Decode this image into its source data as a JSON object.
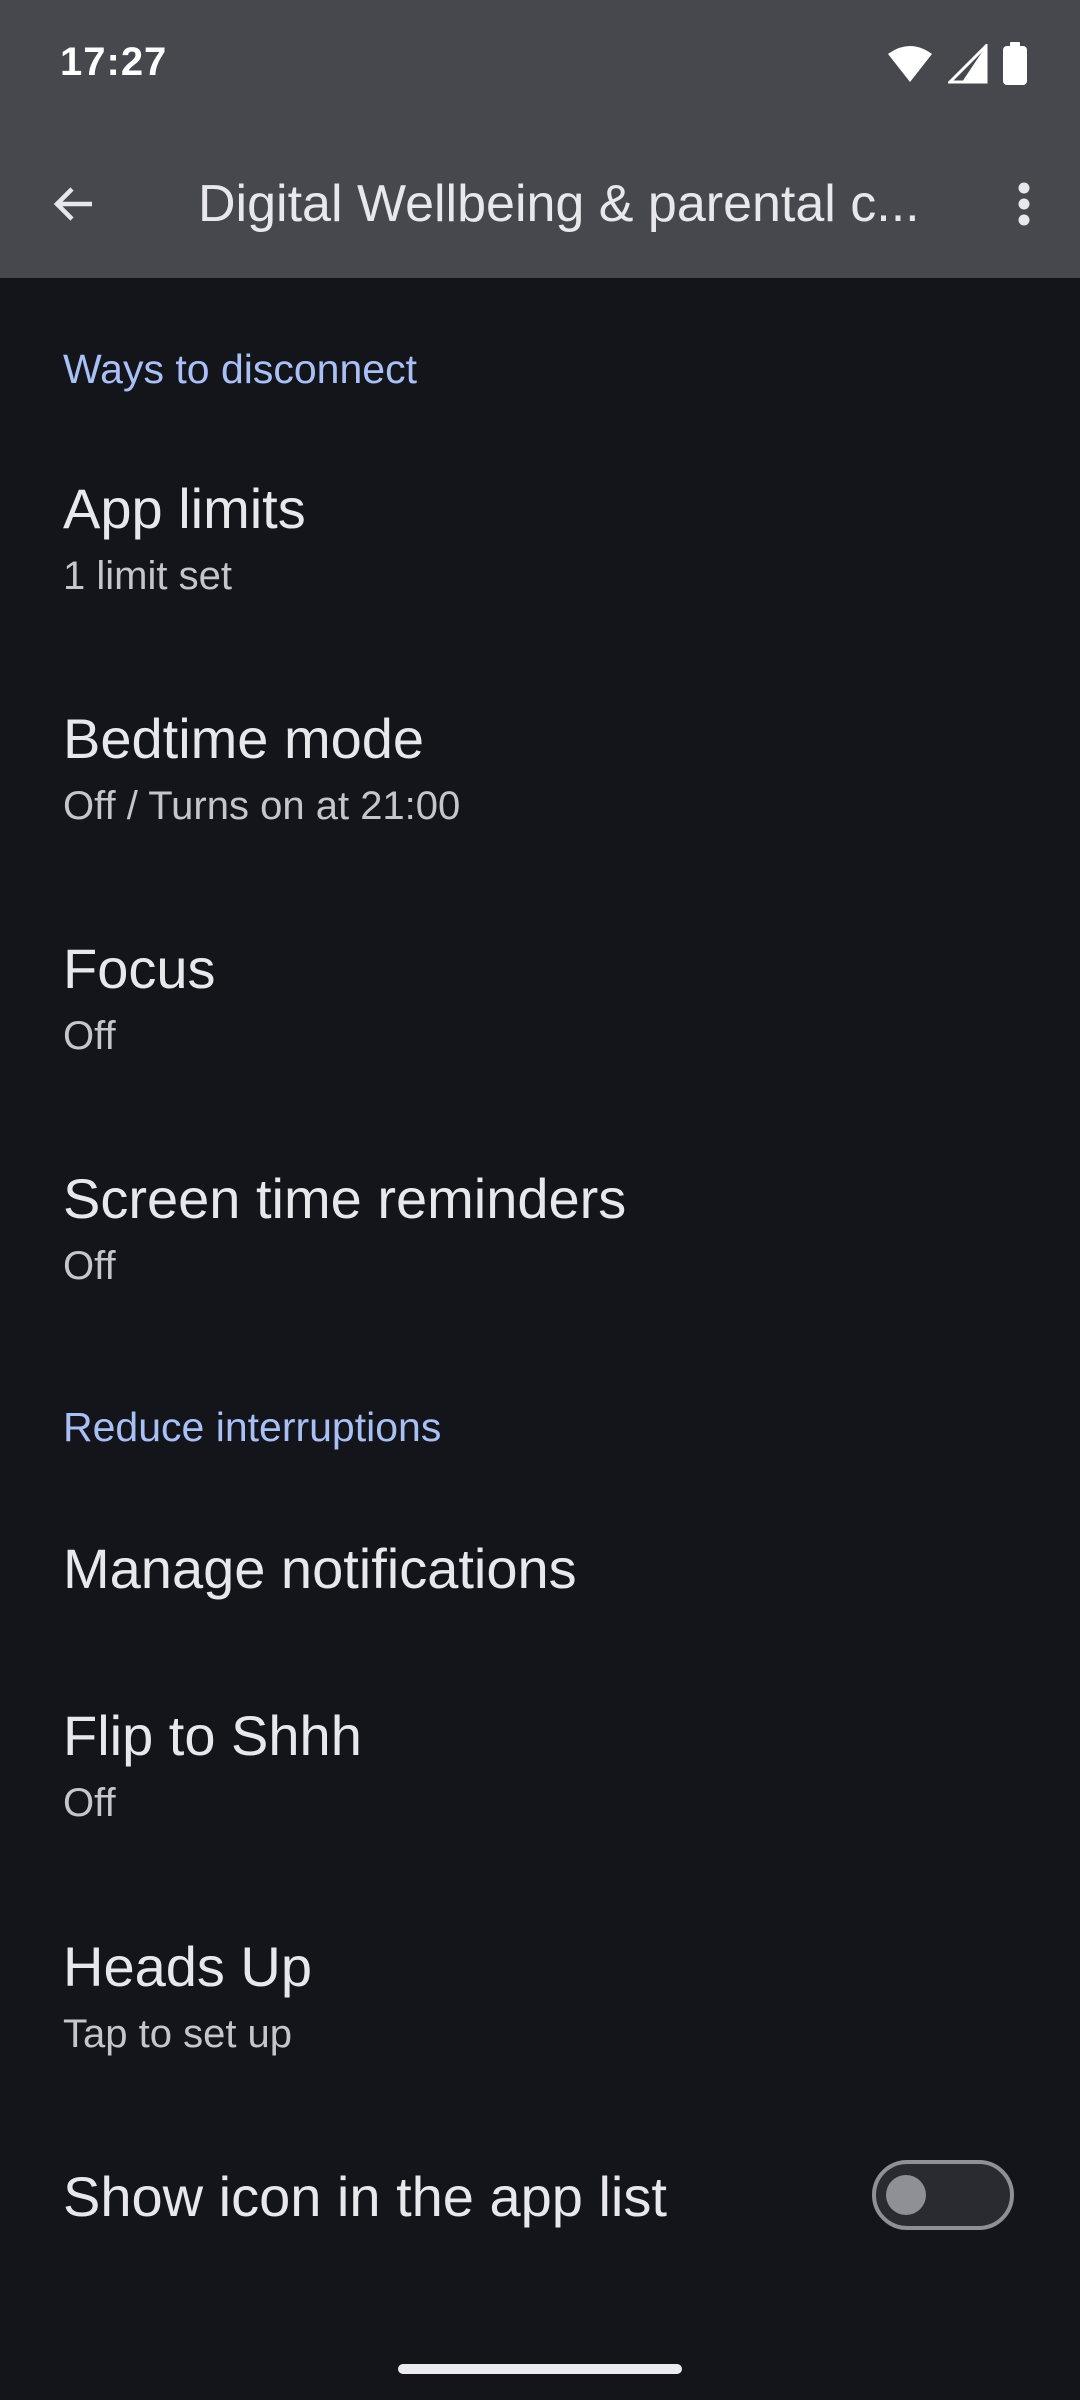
{
  "status_bar": {
    "time": "17:27",
    "icons": [
      "wifi-icon",
      "signal-icon",
      "battery-icon"
    ]
  },
  "app_bar": {
    "title": "Digital Wellbeing & parental c...",
    "back_icon": "arrow-back-icon",
    "more_icon": "more-vert-icon"
  },
  "sections": {
    "disconnect": {
      "header": "Ways to disconnect",
      "items": [
        {
          "title": "App limits",
          "subtitle": "1 limit set"
        },
        {
          "title": "Bedtime mode",
          "subtitle": "Off / Turns on at 21:00"
        },
        {
          "title": "Focus",
          "subtitle": "Off"
        },
        {
          "title": "Screen time reminders",
          "subtitle": "Off"
        }
      ]
    },
    "interruptions": {
      "header": "Reduce interruptions",
      "items": [
        {
          "title": "Manage notifications"
        },
        {
          "title": "Flip to Shhh",
          "subtitle": "Off"
        },
        {
          "title": "Heads Up",
          "subtitle": "Tap to set up"
        }
      ]
    }
  },
  "show_icon": {
    "title": "Show icon in the app list",
    "enabled": false
  },
  "colors": {
    "background": "#14151b",
    "app_bar": "#47484d",
    "accent": "#a8c0f5"
  }
}
